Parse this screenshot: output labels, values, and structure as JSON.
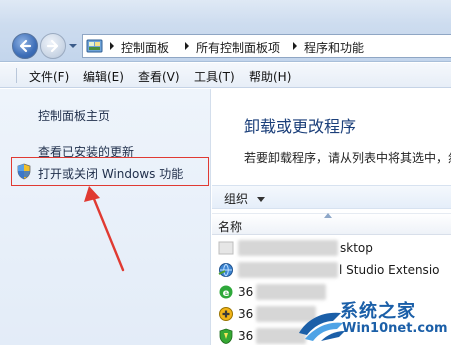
{
  "address_bar": {
    "crumbs": [
      "控制面板",
      "所有控制面板项",
      "程序和功能"
    ]
  },
  "menu": {
    "items": [
      "文件(F)",
      "编辑(E)",
      "查看(V)",
      "工具(T)",
      "帮助(H)"
    ]
  },
  "left_pane": {
    "links": [
      "控制面板主页",
      "查看已安装的更新",
      "打开或关闭 Windows 功能"
    ]
  },
  "content": {
    "title": "卸载或更改程序",
    "description": "若要卸载程序，请从列表中将其选中，然",
    "organize_label": "组织",
    "column_name": "名称",
    "programs": [
      {
        "visible_text": "sktop",
        "icon": "generic-app-icon"
      },
      {
        "visible_text": "l Studio Extensio",
        "icon": "dotnet-globe-icon"
      },
      {
        "visible_text": "36",
        "icon": "ie-360-icon"
      },
      {
        "visible_text": "36",
        "icon": "360-plus-icon"
      },
      {
        "visible_text": "36",
        "icon": "360-shield-icon"
      }
    ]
  },
  "watermark": {
    "brand": "系统之家",
    "url": "Win10net.com"
  },
  "colors": {
    "annotation_red": "#e03a32",
    "title_blue": "#1b3f7a",
    "watermark_blue": "#1b5fa8"
  }
}
